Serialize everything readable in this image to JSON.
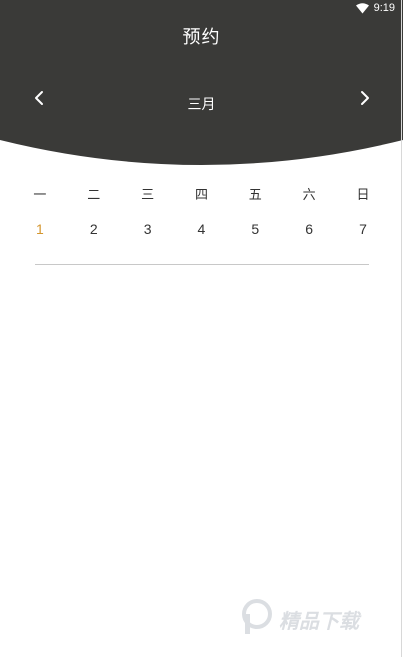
{
  "status_bar": {
    "time": "9:19",
    "icons": [
      "wifi-icon"
    ]
  },
  "header": {
    "title": "预约",
    "background_color": "#3a3a38",
    "month": "三月",
    "prev_icon": "chevron-left-icon",
    "next_icon": "chevron-right-icon"
  },
  "calendar": {
    "weekdays": [
      "一",
      "二",
      "三",
      "四",
      "五",
      "六",
      "日"
    ],
    "dates": [
      "1",
      "2",
      "3",
      "4",
      "5",
      "6",
      "7"
    ],
    "selected_index": 0,
    "selected_color": "#d4962e"
  },
  "watermark": {
    "text": "精品下载"
  }
}
